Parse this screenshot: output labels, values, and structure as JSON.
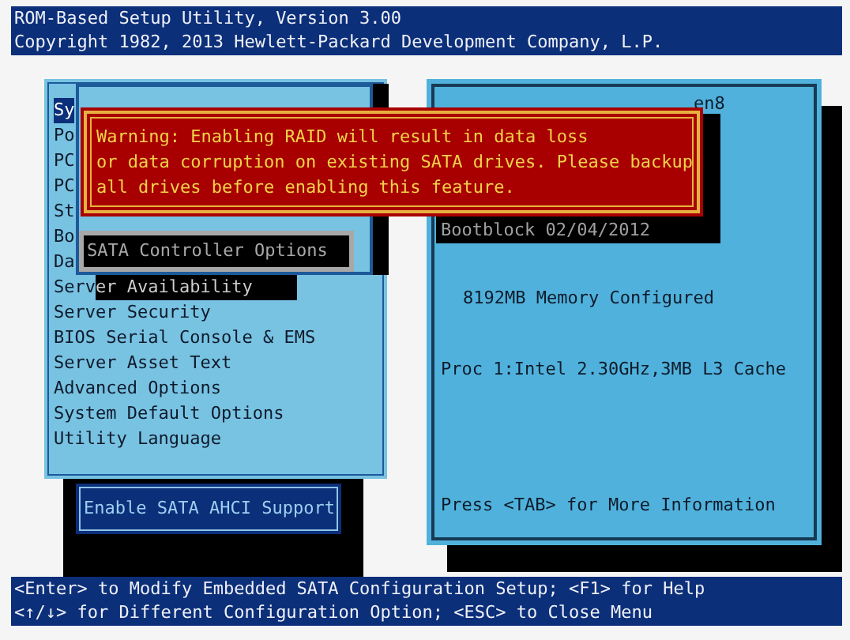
{
  "header": {
    "lines": [
      "ROM-Based Setup Utility, Version 3.00",
      "Copyright 1982, 2013 Hewlett-Packard Development Company, L.P."
    ]
  },
  "main_menu": {
    "items": [
      {
        "label": "Sy",
        "selected": true,
        "kind": "plain"
      },
      {
        "label": "Po",
        "selected": false,
        "kind": "plain"
      },
      {
        "label": "PC",
        "selected": false,
        "kind": "plain"
      },
      {
        "label": "PC",
        "selected": false,
        "kind": "plain"
      },
      {
        "label": "St",
        "selected": false,
        "kind": "plain"
      },
      {
        "label": "Bo",
        "selected": false,
        "kind": "plain"
      },
      {
        "label": "Da",
        "selected": false,
        "kind": "plain"
      },
      {
        "label": "Server Availability",
        "selected": false,
        "kind": "shadowed"
      },
      {
        "label": "Server Security",
        "selected": false,
        "kind": "plain"
      },
      {
        "label": "BIOS Serial Console & EMS",
        "selected": false,
        "kind": "plain"
      },
      {
        "label": "Server Asset Text",
        "selected": false,
        "kind": "plain"
      },
      {
        "label": "Advanced Options",
        "selected": false,
        "kind": "plain"
      },
      {
        "label": "System Default Options",
        "selected": false,
        "kind": "plain"
      },
      {
        "label": "Utility Language",
        "selected": false,
        "kind": "plain"
      }
    ]
  },
  "submenu": {
    "item": "SATA Controller Options"
  },
  "warning": {
    "lines": [
      "Warning: Enabling RAID will result in data loss",
      "or data corruption on existing SATA drives. Please backup",
      "all drives before enabling this feature."
    ]
  },
  "system_info": {
    "title_fragment": "en8",
    "bootblock": "Bootblock 02/04/2012",
    "memory": "8192MB Memory Configured",
    "processor": "Proc 1:Intel 2.30GHz,3MB L3 Cache",
    "hint": "Press <TAB> for More Information"
  },
  "help_box": {
    "text": "Enable SATA AHCI Support"
  },
  "footer": {
    "lines": [
      "<Enter> to Modify Embedded SATA Configuration Setup; <F1> for Help",
      "<↑/↓> for Different Configuration Option; <ESC> to Close Menu"
    ]
  }
}
